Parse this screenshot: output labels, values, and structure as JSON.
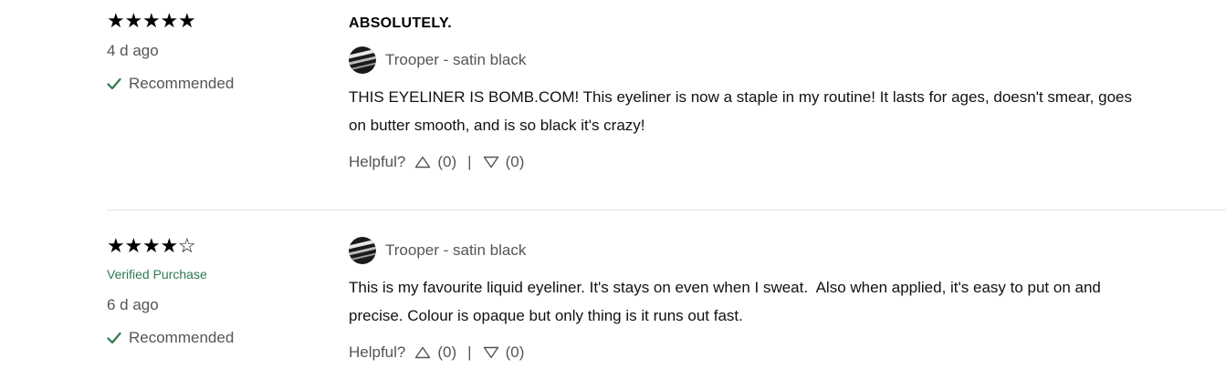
{
  "reviews": [
    {
      "stars_filled": 5,
      "stars_empty": 0,
      "verified": "",
      "date": "4 d ago",
      "recommended": "Recommended",
      "headline": "ABSOLUTELY.",
      "shade": "Trooper - satin black",
      "body": "THIS EYELINER IS BOMB.COM! This eyeliner is now a staple in my routine! It lasts for ages, doesn't smear, goes\non butter smooth, and is so black it's crazy!",
      "helpful_label": "Helpful?",
      "up_count": "(0)",
      "separator": "|",
      "down_count": "(0)"
    },
    {
      "stars_filled": 4,
      "stars_empty": 1,
      "verified": "Verified Purchase",
      "date": "6 d ago",
      "recommended": "Recommended",
      "headline": "",
      "shade": "Trooper - satin black",
      "body": "This is my favourite liquid eyeliner. It's stays on even when I sweat.  Also when applied, it's easy to put on and\nprecise. Colour is opaque but only thing is it runs out fast.",
      "helpful_label": "Helpful?",
      "up_count": "(0)",
      "separator": "|",
      "down_count": "(0)"
    }
  ],
  "icons": {
    "check": "check-icon",
    "thumb_up": "triangle-up-icon",
    "thumb_down": "triangle-down-icon",
    "swatch": "shade-swatch"
  },
  "colors": {
    "verified": "#2d7a4e",
    "check": "#2d7a4e",
    "muted_text": "#555555"
  }
}
